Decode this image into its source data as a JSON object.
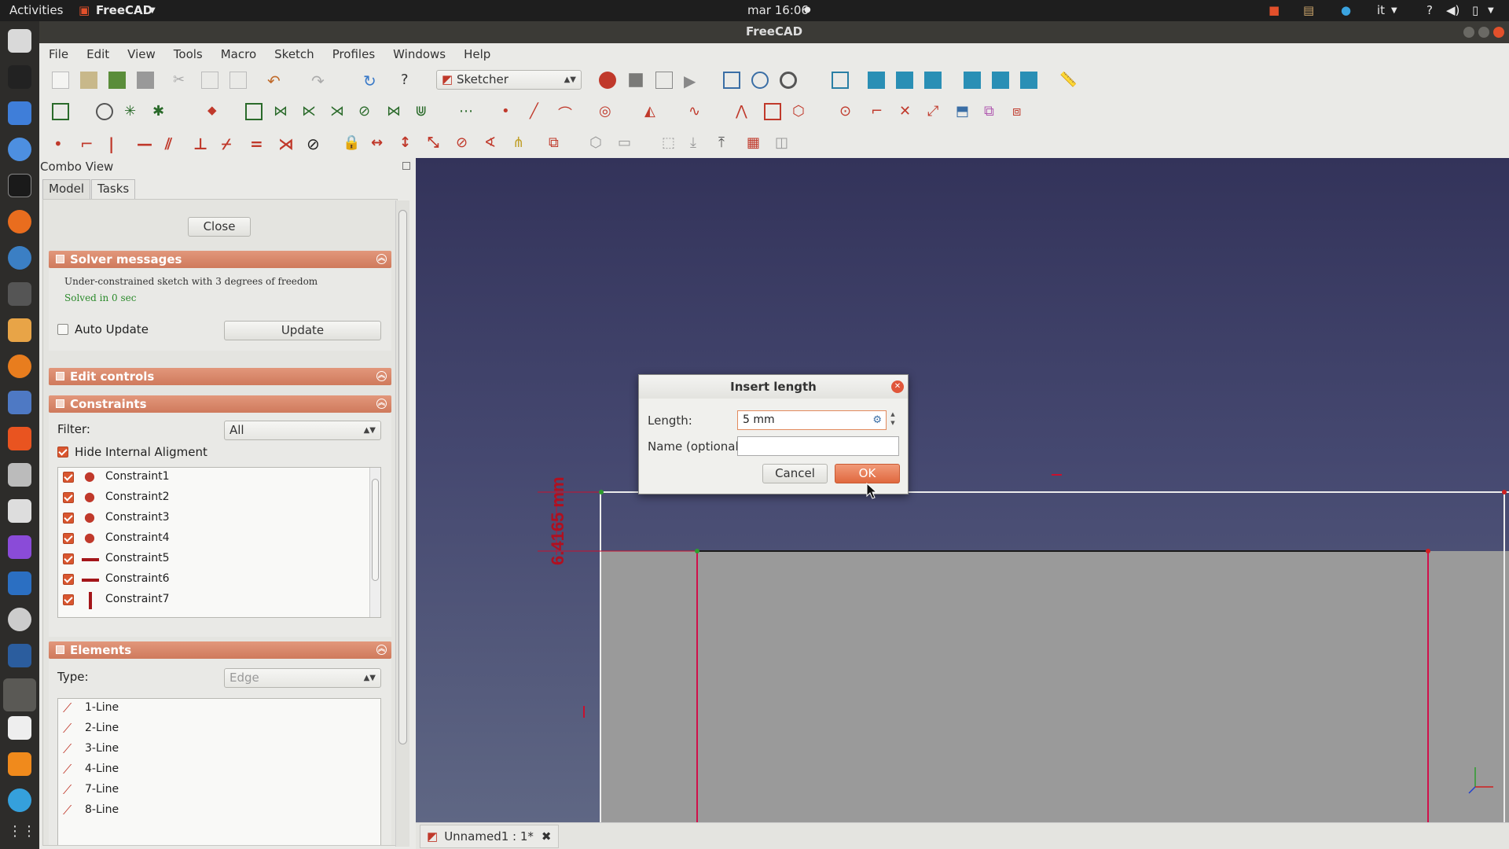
{
  "topbar": {
    "activities": "Activities",
    "app_menu": "FreeCAD",
    "clock": "mar 16:06",
    "lang": "it"
  },
  "window": {
    "title": "FreeCAD"
  },
  "menubar": [
    "File",
    "Edit",
    "View",
    "Tools",
    "Macro",
    "Sketch",
    "Profiles",
    "Windows",
    "Help"
  ],
  "toolbar": {
    "workbench": "Sketcher"
  },
  "combo_view": {
    "title": "Combo View",
    "tabs": [
      "Model",
      "Tasks"
    ],
    "active_tab": "Tasks",
    "close_button": "Close",
    "solver": {
      "header": "Solver messages",
      "message": "Under-constrained sketch with 3 degrees of freedom",
      "solved": "Solved in 0 sec",
      "auto_update": "Auto Update",
      "update_button": "Update"
    },
    "edit_controls": {
      "header": "Edit controls"
    },
    "constraints": {
      "header": "Constraints",
      "filter_label": "Filter:",
      "filter_value": "All",
      "hide_internal": "Hide Internal Aligment",
      "items": [
        {
          "label": "Constraint1",
          "icon": "coincident-icon"
        },
        {
          "label": "Constraint2",
          "icon": "coincident-icon"
        },
        {
          "label": "Constraint3",
          "icon": "coincident-icon"
        },
        {
          "label": "Constraint4",
          "icon": "coincident-icon"
        },
        {
          "label": "Constraint5",
          "icon": "horizontal-icon"
        },
        {
          "label": "Constraint6",
          "icon": "horizontal-icon"
        },
        {
          "label": "Constraint7",
          "icon": "vertical-icon"
        }
      ]
    },
    "elements": {
      "header": "Elements",
      "type_label": "Type:",
      "type_value": "Edge",
      "items": [
        "1-Line",
        "2-Line",
        "3-Line",
        "4-Line",
        "7-Line",
        "8-Line"
      ]
    }
  },
  "viewport": {
    "dimension_label": "6.4165 mm"
  },
  "document_tab": {
    "label": "Unnamed1 : 1*"
  },
  "dialog": {
    "title": "Insert length",
    "length_label": "Length:",
    "length_value": "5 mm",
    "name_label": "Name (optional)",
    "name_value": "",
    "cancel": "Cancel",
    "ok": "OK"
  },
  "colors": {
    "accent": "#e2876a",
    "constraint_red": "#c8102e",
    "viewport_top": "#33335a",
    "viewport_bottom": "#5f6784"
  }
}
